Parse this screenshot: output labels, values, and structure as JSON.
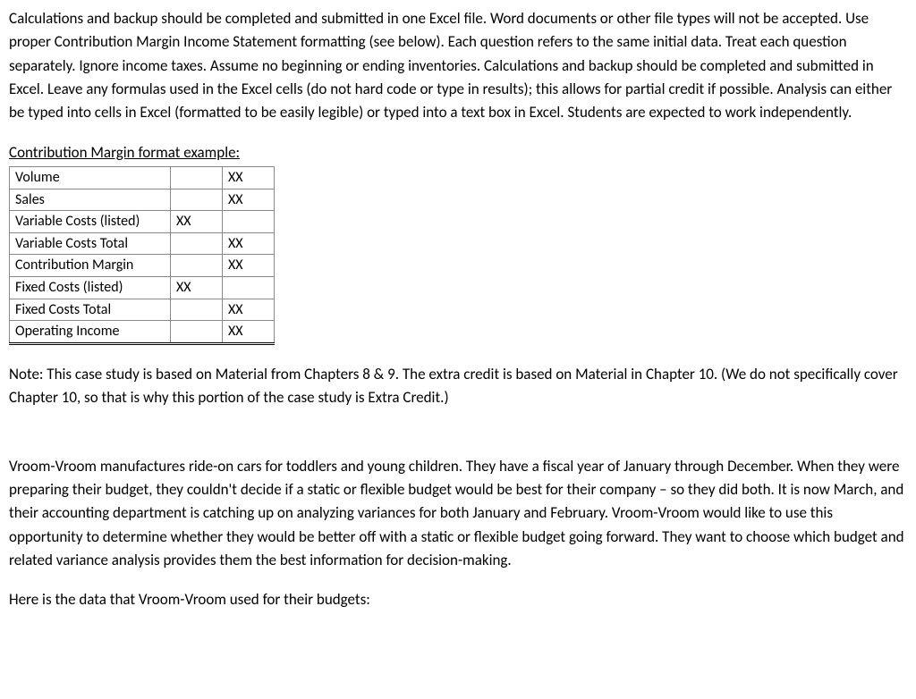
{
  "intro_paragraph": "Calculations and backup should be completed and submitted in one Excel file. Word documents or other file types will not be accepted. Use proper Contribution Margin Income Statement formatting (see below). Each question refers to the same initial data. Treat each question separately. Ignore income taxes. Assume no beginning or ending inventories. Calculations and backup should be completed and submitted in Excel. Leave any formulas used in the Excel cells (do not hard code or type in results); this allows for partial credit if possible. Analysis can either be typed into cells in Excel (formatted to be easily legible) or typed into a text box in Excel. Students are expected to work independently.",
  "format_header": "Contribution Margin format example:",
  "cm_table": {
    "rows": [
      {
        "label": "Volume",
        "col1": "",
        "col2": "XX"
      },
      {
        "label": "Sales",
        "col1": "",
        "col2": "XX"
      },
      {
        "label": "Variable Costs (listed)",
        "col1": "XX",
        "col2": ""
      },
      {
        "label": "Variable Costs Total",
        "col1": "",
        "col2": "XX"
      },
      {
        "label": "Contribution Margin",
        "col1": "",
        "col2": "XX"
      },
      {
        "label": "Fixed Costs (listed)",
        "col1": "XX",
        "col2": ""
      },
      {
        "label": "Fixed Costs Total",
        "col1": "",
        "col2": "XX"
      },
      {
        "label": "Operating Income",
        "col1": "",
        "col2": "XX"
      }
    ]
  },
  "note_text": "Note: This case study is based on Material from Chapters 8 & 9. The extra credit is based on Material in Chapter 10. (We do not specifically cover Chapter 10, so that is why this portion of the case study is Extra Credit.)",
  "scenario_text": "Vroom-Vroom manufactures ride-on cars for toddlers and young children. They have a fiscal year of January through December. When they were preparing their budget, they couldn't decide if a static or flexible budget would be best for their company – so they did both. It is now March, and their accounting department is catching up on analyzing variances for both January and February. Vroom-Vroom would like to use this opportunity to determine whether they would be better off with a static or flexible budget going forward. They want to choose which budget and related variance analysis provides them the best information for decision-making.",
  "data_intro": "Here is the data that Vroom-Vroom used for their budgets:"
}
